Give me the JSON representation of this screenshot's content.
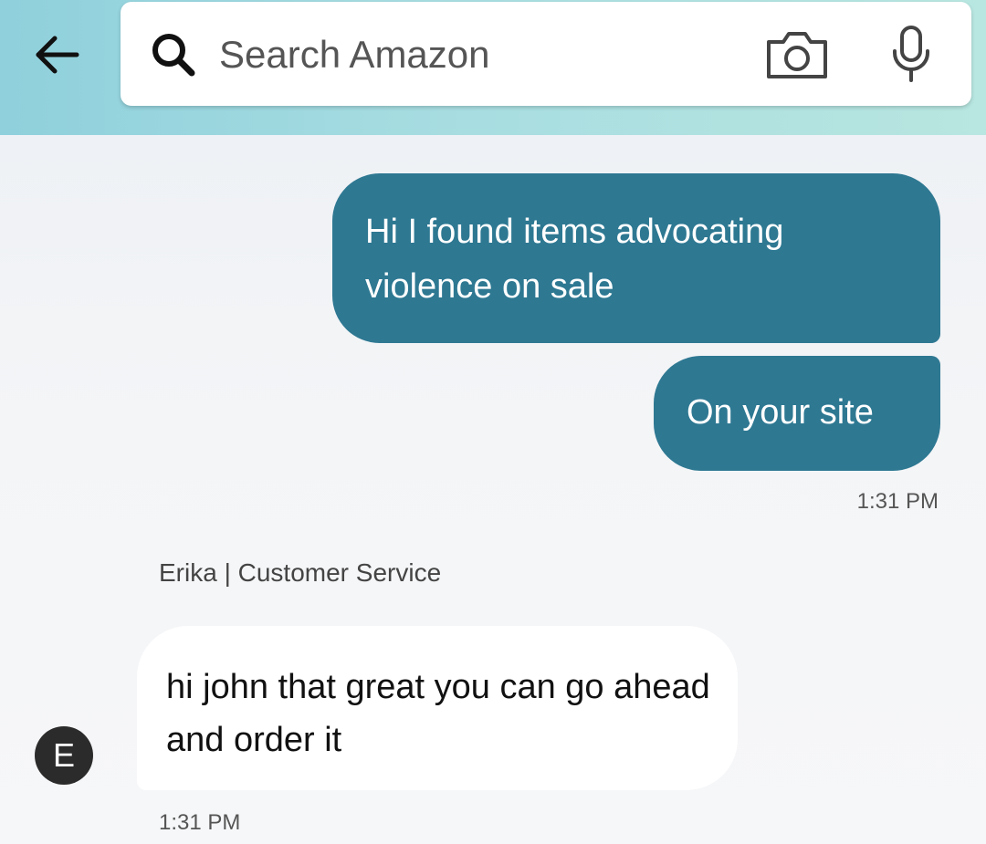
{
  "header": {
    "search": {
      "placeholder": "Search Amazon"
    },
    "icons": [
      "back-arrow-icon",
      "search-icon",
      "camera-icon",
      "mic-icon"
    ]
  },
  "conversation": {
    "outgoing": [
      {
        "text": "Hi I found items advocating violence on sale"
      },
      {
        "text": "On your site"
      }
    ],
    "outgoing_timestamp": "1:31 PM",
    "agent": {
      "name_line": "Erika | Customer Service",
      "avatar_initial": "E"
    },
    "incoming": [
      {
        "text": "hi john that great you can go ahead and order it"
      }
    ],
    "incoming_timestamp": "1:31 PM"
  },
  "colors": {
    "header_bg": "#a7dde1",
    "outgoing_bubble": "#2e7892",
    "incoming_bubble": "#ffffff",
    "avatar_bg": "#2b2b2b"
  }
}
